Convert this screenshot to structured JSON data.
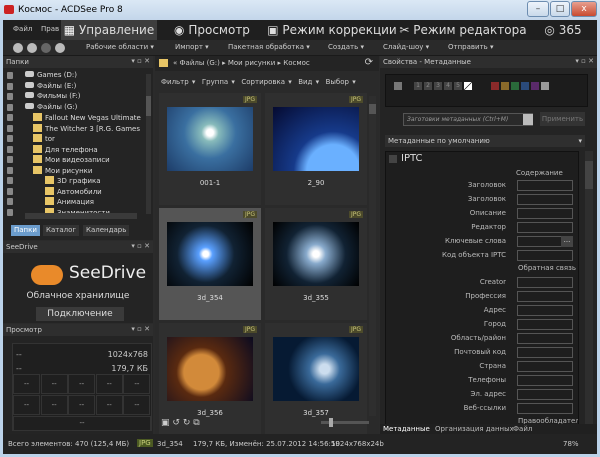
{
  "window": {
    "title": "Космос - ACDSee Pro 8",
    "min": "–",
    "max": "□",
    "close": "x"
  },
  "menu": [
    "Файл",
    "Прав"
  ],
  "modes": [
    {
      "label": "Управление",
      "icon": "grid-icon"
    },
    {
      "label": "Просмотр",
      "icon": "eye-icon"
    },
    {
      "label": "Режим коррекции",
      "icon": "image-icon"
    },
    {
      "label": "Режим редактора",
      "icon": "tools-icon"
    },
    {
      "label": "365",
      "icon": "365-icon"
    }
  ],
  "toolbar": [
    "Рабочие области ▾",
    "Импорт ▾",
    "Пакетная обработка ▾",
    "Создать ▾",
    "Слайд-шоу ▾",
    "Отправить ▾"
  ],
  "folders": {
    "title": "Папки",
    "items": [
      {
        "label": "Games (D:)",
        "type": "drive"
      },
      {
        "label": "Файлы (E:)",
        "type": "drive"
      },
      {
        "label": "Фильмы (F:)",
        "type": "drive"
      },
      {
        "label": "Файлы (G:)",
        "type": "drive"
      },
      {
        "label": "Fallout New Vegas Ultimate",
        "type": "folder"
      },
      {
        "label": "The Witcher 3 [R.G. Games",
        "type": "folder"
      },
      {
        "label": "tor",
        "type": "folder"
      },
      {
        "label": "Для телефона",
        "type": "folder"
      },
      {
        "label": "Мои видеозаписи",
        "type": "folder"
      },
      {
        "label": "Мои рисунки",
        "type": "folder"
      },
      {
        "label": "3D графика",
        "type": "folder"
      },
      {
        "label": "Автомобили",
        "type": "folder"
      },
      {
        "label": "Анимация",
        "type": "folder"
      },
      {
        "label": "Знаменитости",
        "type": "folder"
      }
    ],
    "tabs": [
      "Папки",
      "Каталог",
      "Календарь"
    ]
  },
  "seedrive": {
    "title": "SeeDrive",
    "brand": "SeeDrive",
    "subtitle": "Облачное хранилище",
    "button": "Подключение"
  },
  "preview": {
    "title": "Просмотр",
    "dims": "1024x768",
    "size": "179,7 КБ",
    "empty": "--"
  },
  "browser": {
    "crumbs": [
      "Файлы (G:)",
      "Мои рисунки",
      "Космос"
    ],
    "filters": [
      "Фильтр ▾",
      "Группа ▾",
      "Сортировка ▾",
      "Вид ▾",
      "Выбор ▾"
    ],
    "thumbs": [
      {
        "name": "001-1",
        "badge": "JPG"
      },
      {
        "name": "2_90",
        "badge": "JPG"
      },
      {
        "name": "3d_354",
        "badge": "JPG",
        "selected": true
      },
      {
        "name": "3d_355",
        "badge": "JPG"
      },
      {
        "name": "3d_356",
        "badge": "JPG"
      },
      {
        "name": "3d_357",
        "badge": "JPG"
      }
    ]
  },
  "props": {
    "title": "Свойства - Метаданные",
    "ratings": [
      "1",
      "2",
      "3",
      "4",
      "5"
    ],
    "colors": [
      "#8a2a2a",
      "#8a6a2a",
      "#2a6a3a",
      "#2a4a7a",
      "#5a2a6a",
      "#999999"
    ],
    "preset_placeholder": "Заготовки метаданных (Ctrl+M)",
    "apply": "Применить",
    "dropdown": "Метаданные по умолчанию",
    "section": "IPTC",
    "col_header": "Содержание",
    "fields": [
      "Заголовок",
      "Заголовок",
      "Описание",
      "Редактор",
      "Ключевые слова",
      "Код объекта IPTC"
    ],
    "contact_header": "Обратная связь",
    "contact": [
      "Creator",
      "Профессия",
      "Адрес",
      "Город",
      "Область/район",
      "Почтовый код",
      "Страна",
      "Телефоны",
      "Эл. адрес",
      "Веб-ссылки"
    ],
    "copyright": "Правообладател",
    "more": "...",
    "tabs": [
      "Метаданные",
      "Организация данных",
      "Файл"
    ]
  },
  "status": {
    "total": "Всего элементов: 470  (125,4 МБ)",
    "badge": "JPG",
    "file": "3d_354",
    "info": "179,7 КБ, Изменён: 25.07.2012 14:56:59",
    "dims": "1024x768x24b",
    "zoom": "78%"
  }
}
